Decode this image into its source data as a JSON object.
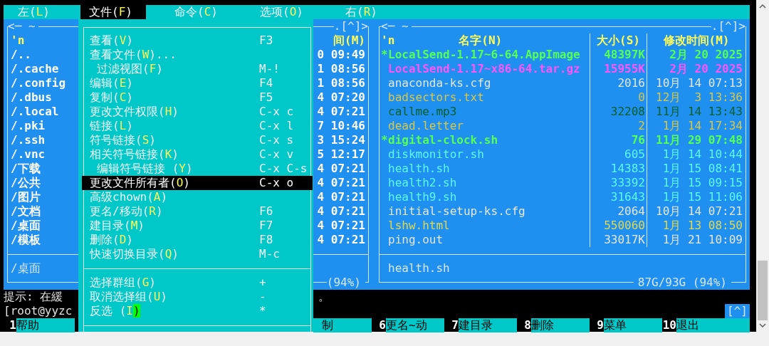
{
  "menubar": [
    {
      "label": "左(",
      "hotkey": "L",
      "after": ")",
      "selected": false
    },
    {
      "label": "文件(",
      "hotkey": "F",
      "after": ")",
      "selected": true
    },
    {
      "label": "命令(",
      "hotkey": "C",
      "after": ")",
      "selected": false
    },
    {
      "label": "选项(",
      "hotkey": "O",
      "after": ")",
      "selected": false
    },
    {
      "label": "右(",
      "hotkey": "R",
      "after": ")",
      "selected": false
    }
  ],
  "left_panel": {
    "header_left": "<─ ~",
    "header_right": ".[^]>",
    "name_heading": "'n",
    "time_heading": "间(M)",
    "rows": [
      {
        "name": "/..",
        "time": "0 09:49"
      },
      {
        "name": "/.cache",
        "time": "1 08:56"
      },
      {
        "name": "/.config",
        "time": "1 08:56"
      },
      {
        "name": "/.dbus",
        "time": "4 07:20"
      },
      {
        "name": "/.local",
        "time": "4 07:21"
      },
      {
        "name": "/.pki",
        "time": "7 10:46"
      },
      {
        "name": "/.ssh",
        "time": "3 15:24"
      },
      {
        "name": "/.vnc",
        "time": "5 12:17"
      },
      {
        "name": "/下载",
        "time": "4 07:21"
      },
      {
        "name": "/公共",
        "time": "4 07:21"
      },
      {
        "name": "/图片",
        "time": "4 07:21"
      },
      {
        "name": "/文档",
        "time": "4 07:21"
      },
      {
        "name": "/桌面",
        "time": "4 07:21"
      },
      {
        "name": "/模板",
        "time": "4 07:21"
      }
    ],
    "mini_status": "/桌面",
    "footer": "(94%)"
  },
  "file_menu": [
    {
      "kind": "item",
      "label": "查看(",
      "hotkey": "V",
      "after": ")",
      "shortcut": "F3",
      "indented": false,
      "selected": false,
      "cursor": false
    },
    {
      "kind": "item",
      "label": "查看文件(",
      "hotkey": "W",
      "after": ")...",
      "indented": false,
      "selected": false,
      "cursor": false
    },
    {
      "kind": "item",
      "label": "过滤视图(",
      "hotkey": "F",
      "after": ")",
      "shortcut": "M-!",
      "indented": true,
      "selected": false,
      "cursor": false
    },
    {
      "kind": "item",
      "label": "编辑(",
      "hotkey": "E",
      "after": ")",
      "shortcut": "F4",
      "indented": false,
      "selected": false,
      "cursor": false
    },
    {
      "kind": "item",
      "label": "复制(",
      "hotkey": "C",
      "after": ")",
      "shortcut": "F5",
      "indented": false,
      "selected": false,
      "cursor": false
    },
    {
      "kind": "item",
      "label": "更改文件权限(",
      "hotkey": "H",
      "after": ")",
      "shortcut": "C-x c",
      "indented": false,
      "selected": false,
      "cursor": false
    },
    {
      "kind": "item",
      "label": "链接(",
      "hotkey": "L",
      "after": ")",
      "shortcut": "C-x l",
      "indented": false,
      "selected": false,
      "cursor": false
    },
    {
      "kind": "item",
      "label": "符号链接(",
      "hotkey": "S",
      "after": ")",
      "shortcut": "C-x s",
      "indented": false,
      "selected": false,
      "cursor": false
    },
    {
      "kind": "item",
      "label": "相关符号链接(",
      "hotkey": "K",
      "after": ")",
      "shortcut": "C-x v",
      "indented": false,
      "selected": false,
      "cursor": false
    },
    {
      "kind": "item",
      "label": "编辑符号链接 (",
      "hotkey": "Y",
      "after": ")",
      "shortcut": "C-x C-s",
      "indented": true,
      "selected": false,
      "cursor": false
    },
    {
      "kind": "item",
      "label": "更改文件所有者(",
      "hotkey": "O",
      "after": ")",
      "shortcut": "C-x o",
      "indented": false,
      "selected": true,
      "cursor": false
    },
    {
      "kind": "item",
      "label": "高级chown(",
      "hotkey": "A",
      "after": ")",
      "indented": false,
      "selected": false,
      "cursor": false
    },
    {
      "kind": "item",
      "label": "更名/移动(",
      "hotkey": "R",
      "after": ")",
      "shortcut": "F6",
      "indented": false,
      "selected": false,
      "cursor": false
    },
    {
      "kind": "item",
      "label": "建目录(",
      "hotkey": "M",
      "after": ")",
      "shortcut": "F7",
      "indented": false,
      "selected": false,
      "cursor": false
    },
    {
      "kind": "item",
      "label": "删除(",
      "hotkey": "D",
      "after": ")",
      "shortcut": "F8",
      "indented": false,
      "selected": false,
      "cursor": false
    },
    {
      "kind": "item",
      "label": "快速切换目录(",
      "hotkey": "Q",
      "after": ")",
      "shortcut": "M-c",
      "indented": false,
      "selected": false,
      "cursor": false
    },
    {
      "kind": "separator"
    },
    {
      "kind": "item",
      "label": "选择群组(",
      "hotkey": "G",
      "after": ")",
      "shortcut": "+",
      "indented": false,
      "selected": false,
      "cursor": false
    },
    {
      "kind": "item",
      "label": "取消选择组(",
      "hotkey": "U",
      "after": ")",
      "shortcut": "-",
      "indented": false,
      "selected": false,
      "cursor": false
    },
    {
      "kind": "item",
      "label": "反选 (",
      "hotkey": "I",
      "after": ")",
      "shortcut": "*",
      "indented": false,
      "selected": false,
      "cursor": true
    },
    {
      "kind": "separator"
    }
  ],
  "right_panel": {
    "header_left": "<─ ~",
    "header_right": ".[^]>",
    "columns": [
      "'n",
      "名字(N)",
      "大小(S)",
      "修改时间(M)"
    ],
    "rows": [
      {
        "marker": "*",
        "name": "LocalSend-1.17~6-64.AppImage",
        "size": "48397K",
        "date": "2月 20 2025",
        "color": "#55ff55",
        "bold": true
      },
      {
        "name": "LocalSend-1.17~x86-64.tar.gz",
        "size": "15955K",
        "date": "2月 20 2025",
        "color": "#ff55ff",
        "bold": true
      },
      {
        "name": "anaconda-ks.cfg",
        "size": "2016",
        "date": "10月 14 07:13",
        "color": "#e6e6e6",
        "bold": false
      },
      {
        "name": "badsectors.txt",
        "size": "0",
        "date": "12月  3 13:36",
        "color": "#d8c848",
        "bold": false
      },
      {
        "name": "callme.mp3",
        "size": "32208",
        "date": "11月 14 13:43",
        "color": "#00602a",
        "bold": false
      },
      {
        "name": "dead.letter",
        "size": "2",
        "date": "1月 14 17:34",
        "color": "#d8c848",
        "bold": false
      },
      {
        "marker": "*",
        "name": "digital-clock.sh",
        "size": "76",
        "date": "11月 29 07:48",
        "color": "#55ff55",
        "bold": true
      },
      {
        "name": "diskmonitor.sh",
        "size": "605",
        "date": "1月 14 10:44",
        "color": "#5ef8ff",
        "bold": false
      },
      {
        "name": "health.sh",
        "size": "14383",
        "date": "1月 15 08:41",
        "color": "#5ef8ff",
        "bold": false
      },
      {
        "name": "health2.sh",
        "size": "33392",
        "date": "1月 15 09:15",
        "color": "#5ef8ff",
        "bold": false
      },
      {
        "name": "health9.sh",
        "size": "31643",
        "date": "1月 15 11:06",
        "color": "#5ef8ff",
        "bold": false
      },
      {
        "name": "initial-setup-ks.cfg",
        "size": "2064",
        "date": "10月 14 07:21",
        "color": "#e6e6e6",
        "bold": false
      },
      {
        "name": "lshw.html",
        "size": "550060",
        "date": "1月 13 08:50",
        "color": "#e0d850",
        "bold": false
      },
      {
        "name": "ping.out",
        "size": "33017K",
        "date": "1月 21 10:09",
        "color": "#e6e6e6",
        "bold": false
      }
    ],
    "mini_status": "health.sh",
    "footer": "87G/93G (94%)"
  },
  "hint": {
    "text": "提示: 在緩",
    "tail": "。"
  },
  "command_line": {
    "prompt": "[root@yyzc",
    "history_button": "[^]"
  },
  "function_keys": [
    {
      "number": "1",
      "label": "帮助"
    },
    {
      "label": "制"
    },
    {
      "number": "6",
      "label": "更名~动"
    },
    {
      "number": "7",
      "label": "建目录"
    },
    {
      "number": "8",
      "label": "删除"
    },
    {
      "number": "9",
      "label": "菜单"
    },
    {
      "number": "10",
      "label": "退出"
    }
  ]
}
